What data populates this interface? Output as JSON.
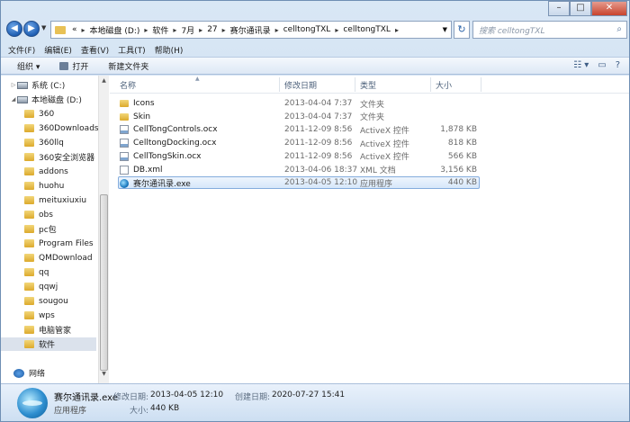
{
  "address": {
    "overflow": "«",
    "crumbs": [
      "本地磁盘 (D:)",
      "软件",
      "7月",
      "27",
      "赛尔通讯录",
      "celltongTXL",
      "celltongTXL"
    ]
  },
  "search": {
    "placeholder": "搜索 celltongTXL"
  },
  "window_controls": {
    "min": "–",
    "max": "□",
    "close": "✕"
  },
  "menu": [
    "文件(F)",
    "编辑(E)",
    "查看(V)",
    "工具(T)",
    "帮助(H)"
  ],
  "toolbar": {
    "organize": "组织 ▾",
    "open": "打开",
    "new_folder": "新建文件夹"
  },
  "sidebar": {
    "items": [
      {
        "label": "系统 (C:)",
        "kind": "drive",
        "level": 1
      },
      {
        "label": "本地磁盘 (D:)",
        "kind": "drive",
        "level": 1,
        "expanded": true
      },
      {
        "label": "360",
        "kind": "folder"
      },
      {
        "label": "360Downloads",
        "kind": "folder"
      },
      {
        "label": "360llq",
        "kind": "folder"
      },
      {
        "label": "360安全浏览器",
        "kind": "folder"
      },
      {
        "label": "addons",
        "kind": "folder"
      },
      {
        "label": "huohu",
        "kind": "folder"
      },
      {
        "label": "meituxiuxiu",
        "kind": "folder"
      },
      {
        "label": "obs",
        "kind": "folder"
      },
      {
        "label": "pc包",
        "kind": "folder"
      },
      {
        "label": "Program Files",
        "kind": "folder"
      },
      {
        "label": "QMDownload",
        "kind": "folder"
      },
      {
        "label": "qq",
        "kind": "folder"
      },
      {
        "label": "qqwj",
        "kind": "folder"
      },
      {
        "label": "sougou",
        "kind": "folder"
      },
      {
        "label": "wps",
        "kind": "folder"
      },
      {
        "label": "电脑管家",
        "kind": "folder"
      },
      {
        "label": "软件",
        "kind": "folder",
        "selected": true
      },
      {
        "label": "网络",
        "kind": "network"
      }
    ]
  },
  "columns": {
    "name": "名称",
    "date": "修改日期",
    "type": "类型",
    "size": "大小"
  },
  "files": [
    {
      "name": "Icons",
      "date": "2013-04-04 7:37",
      "type": "文件夹",
      "size": "",
      "icon": "folder"
    },
    {
      "name": "Skin",
      "date": "2013-04-04 7:37",
      "type": "文件夹",
      "size": "",
      "icon": "folder"
    },
    {
      "name": "CellTongControls.ocx",
      "date": "2011-12-09 8:56",
      "type": "ActiveX 控件",
      "size": "1,878 KB",
      "icon": "ocx"
    },
    {
      "name": "CelltongDocking.ocx",
      "date": "2011-12-09 8:56",
      "type": "ActiveX 控件",
      "size": "818 KB",
      "icon": "ocx"
    },
    {
      "name": "CellTongSkin.ocx",
      "date": "2011-12-09 8:56",
      "type": "ActiveX 控件",
      "size": "566 KB",
      "icon": "ocx"
    },
    {
      "name": "DB.xml",
      "date": "2013-04-06 18:37",
      "type": "XML 文档",
      "size": "3,156 KB",
      "icon": "file"
    },
    {
      "name": "赛尔通讯录.exe",
      "date": "2013-04-05 12:10",
      "type": "应用程序",
      "size": "440 KB",
      "icon": "exe",
      "selected": true
    }
  ],
  "details": {
    "name": "赛尔通讯录.exe",
    "type": "应用程序",
    "modified_label": "修改日期:",
    "modified": "2013-04-05 12:10",
    "created_label": "创建日期:",
    "created": "2020-07-27 15:41",
    "size_label": "大小:",
    "size": "440 KB"
  }
}
